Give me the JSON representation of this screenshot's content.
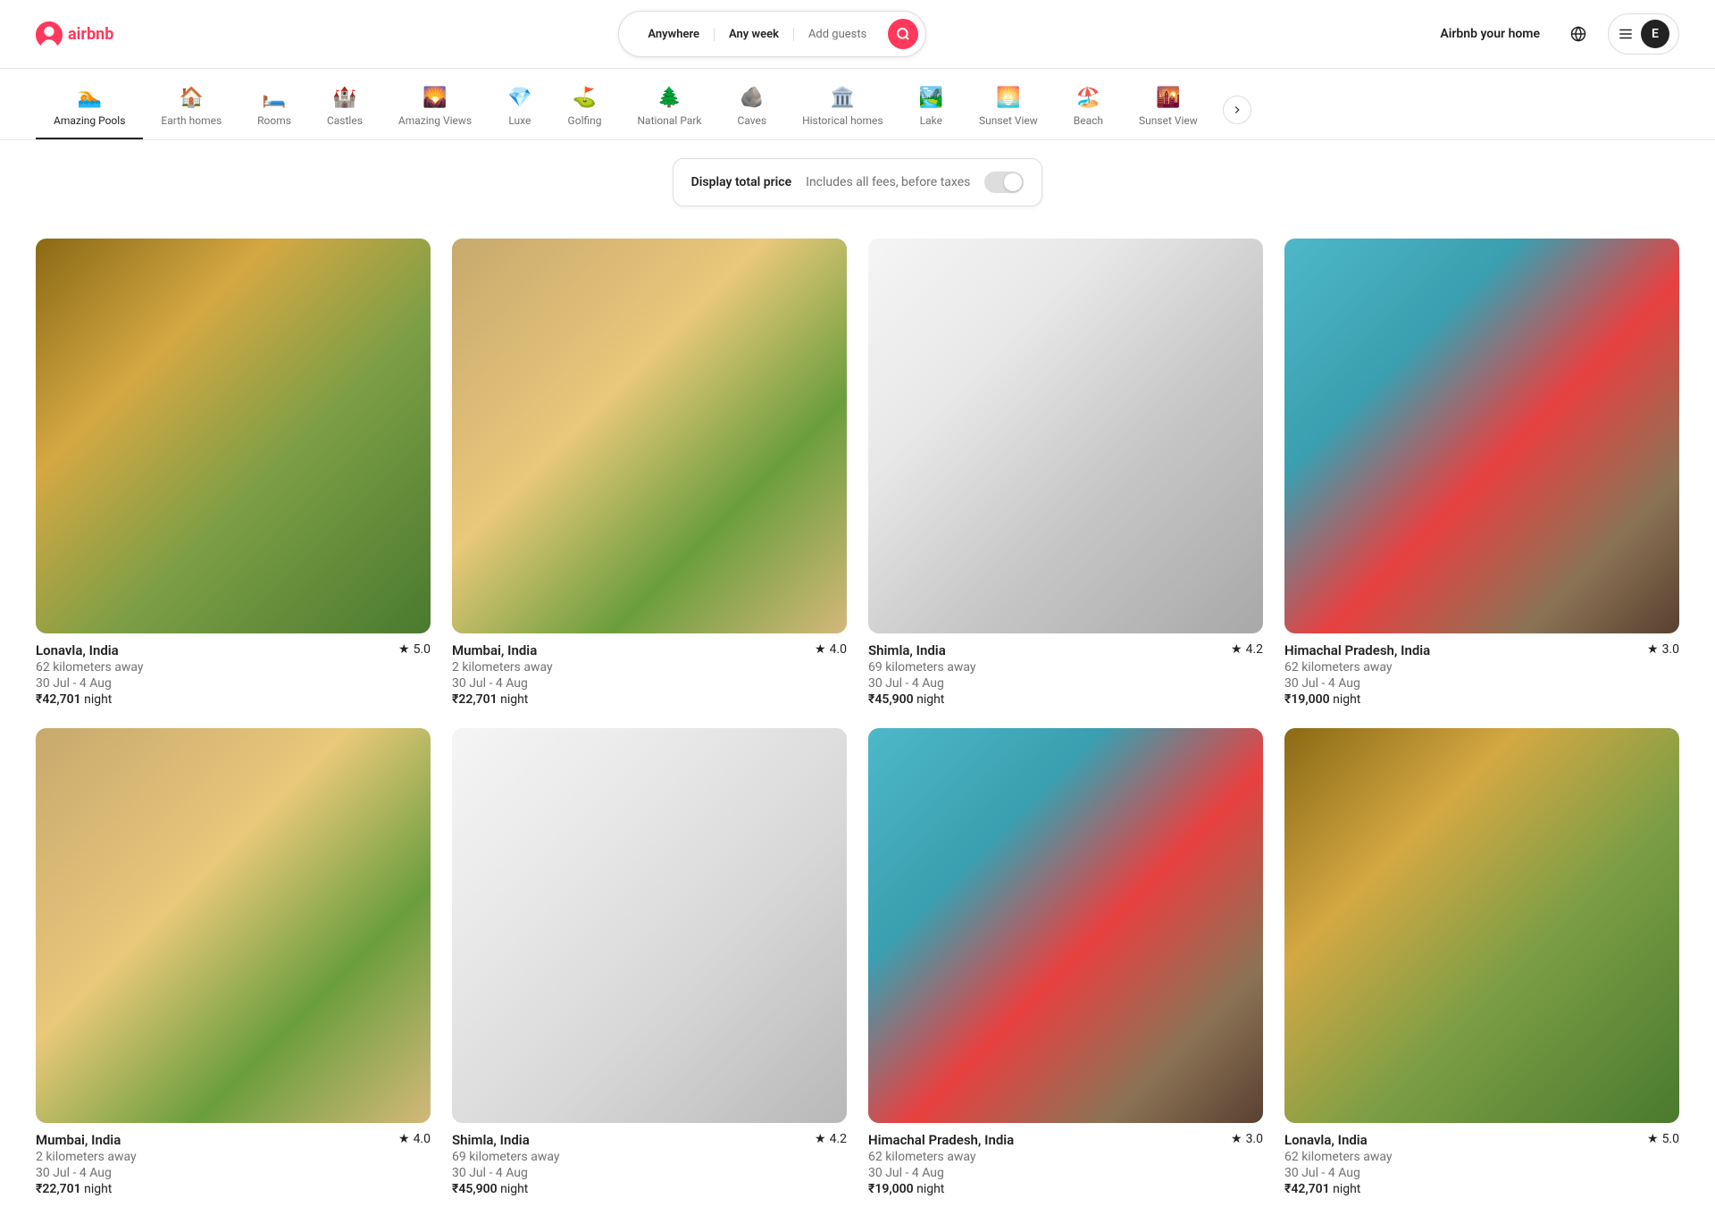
{
  "header": {
    "logo_text": "airbnb",
    "airbnb_your_home": "Airbnb your home",
    "avatar_letter": "E",
    "search": {
      "location_label": "Anywhere",
      "week_label": "Any week",
      "guests_label": "Add guests"
    }
  },
  "categories": [
    {
      "id": "amazing-pools",
      "label": "Amazing Pools",
      "icon": "🏊",
      "active": true
    },
    {
      "id": "earth-homes",
      "label": "Earth homes",
      "icon": "🏠",
      "active": false
    },
    {
      "id": "rooms",
      "label": "Rooms",
      "icon": "🛏️",
      "active": false
    },
    {
      "id": "castles",
      "label": "Castles",
      "icon": "🏰",
      "active": false
    },
    {
      "id": "amazing-views",
      "label": "Amazing Views",
      "icon": "🌄",
      "active": false
    },
    {
      "id": "luxe",
      "label": "Luxe",
      "icon": "💎",
      "active": false
    },
    {
      "id": "golfing",
      "label": "Golfing",
      "icon": "⛳",
      "active": false
    },
    {
      "id": "national-park",
      "label": "National Park",
      "icon": "🌲",
      "active": false
    },
    {
      "id": "caves",
      "label": "Caves",
      "icon": "🪨",
      "active": false
    },
    {
      "id": "historical-homes",
      "label": "Historical homes",
      "icon": "🏛️",
      "active": false
    },
    {
      "id": "lake",
      "label": "Lake",
      "icon": "🏞️",
      "active": false
    },
    {
      "id": "sunset-view",
      "label": "Sunset View",
      "icon": "🌅",
      "active": false
    },
    {
      "id": "beach",
      "label": "Beach",
      "icon": "🏖️",
      "active": false
    },
    {
      "id": "sunset-view2",
      "label": "Sunset View",
      "icon": "🌇",
      "active": false
    }
  ],
  "price_banner": {
    "label": "Display total price",
    "sublabel": "Includes all fees, before taxes"
  },
  "listings": [
    {
      "id": 1,
      "location": "Lonavla, India",
      "distance": "62 kilometers away",
      "dates": "30 Jul - 4 Aug",
      "price": "₹42,701",
      "unit": "night",
      "rating": "5.0",
      "img_class": "img-lonavla"
    },
    {
      "id": 2,
      "location": "Mumbai, India",
      "distance": "2 kilometers away",
      "dates": "30 Jul - 4 Aug",
      "price": "₹22,701",
      "unit": "night",
      "rating": "4.0",
      "img_class": "img-mumbai"
    },
    {
      "id": 3,
      "location": "Shimla, India",
      "distance": "69 kilometers away",
      "dates": "30 Jul - 4 Aug",
      "price": "₹45,900",
      "unit": "night",
      "rating": "4.2",
      "img_class": "img-shimla"
    },
    {
      "id": 4,
      "location": "Himachal Pradesh, India",
      "distance": "62 kilometers away",
      "dates": "30 Jul - 4 Aug",
      "price": "₹19,000",
      "unit": "night",
      "rating": "3.0",
      "img_class": "img-himachal"
    },
    {
      "id": 5,
      "location": "Mumbai, India",
      "distance": "2 kilometers away",
      "dates": "30 Jul - 4 Aug",
      "price": "₹22,701",
      "unit": "night",
      "rating": "4.0",
      "img_class": "img-mumbai2"
    },
    {
      "id": 6,
      "location": "Shimla, India",
      "distance": "69 kilometers away",
      "dates": "30 Jul - 4 Aug",
      "price": "₹45,900",
      "unit": "night",
      "rating": "4.2",
      "img_class": "img-shimla2"
    },
    {
      "id": 7,
      "location": "Himachal Pradesh, India",
      "distance": "62 kilometers away",
      "dates": "30 Jul - 4 Aug",
      "price": "₹19,000",
      "unit": "night",
      "rating": "3.0",
      "img_class": "img-himachal2"
    },
    {
      "id": 8,
      "location": "Lonavla, India",
      "distance": "62 kilometers away",
      "dates": "30 Jul - 4 Aug",
      "price": "₹42,701",
      "unit": "night",
      "rating": "5.0",
      "img_class": "img-lonavla2"
    }
  ]
}
